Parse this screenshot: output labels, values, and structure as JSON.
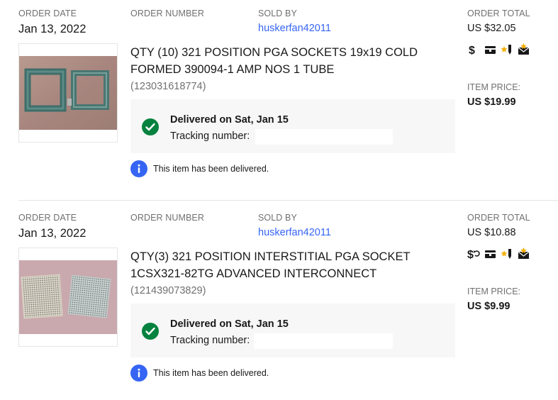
{
  "labels": {
    "order_date": "ORDER DATE",
    "order_number": "ORDER NUMBER",
    "sold_by": "SOLD BY",
    "order_total": "ORDER TOTAL",
    "item_price": "ITEM PRICE:",
    "delivered_notice": "This item has been delivered.",
    "tracking": "Tracking number:"
  },
  "icons": [
    "dollar-icon",
    "package-icon",
    "feedback-star-icon",
    "mail-icon"
  ],
  "colors": {
    "link": "#3665f3",
    "success": "#05823f",
    "info": "#3665f3",
    "muted": "#707070"
  },
  "orders": [
    {
      "order_date": "Jan 13, 2022",
      "order_number": "",
      "seller": "huskerfan42011",
      "order_total": "US $32.05",
      "item_title": "QTY (10) 321 POSITION PGA SOCKETS 19x19 COLD FORMED 390094-1 AMP NOS 1 TUBE",
      "item_number": "(123031618774)",
      "delivery_status": "Delivered on Sat, Jan 15",
      "item_price": "US $19.99",
      "first_icon": "dollar-icon"
    },
    {
      "order_date": "Jan 13, 2022",
      "order_number": "",
      "seller": "huskerfan42011",
      "order_total": "US $10.88",
      "item_title": "QTY(3) 321 POSITION INTERSTITIAL PGA SOCKET 1CSX321-82TG ADVANCED INTERCONNECT",
      "item_number": "(121439073829)",
      "delivery_status": "Delivered on Sat, Jan 15",
      "item_price": "US $9.99",
      "first_icon": "dollar-refund-icon"
    }
  ]
}
